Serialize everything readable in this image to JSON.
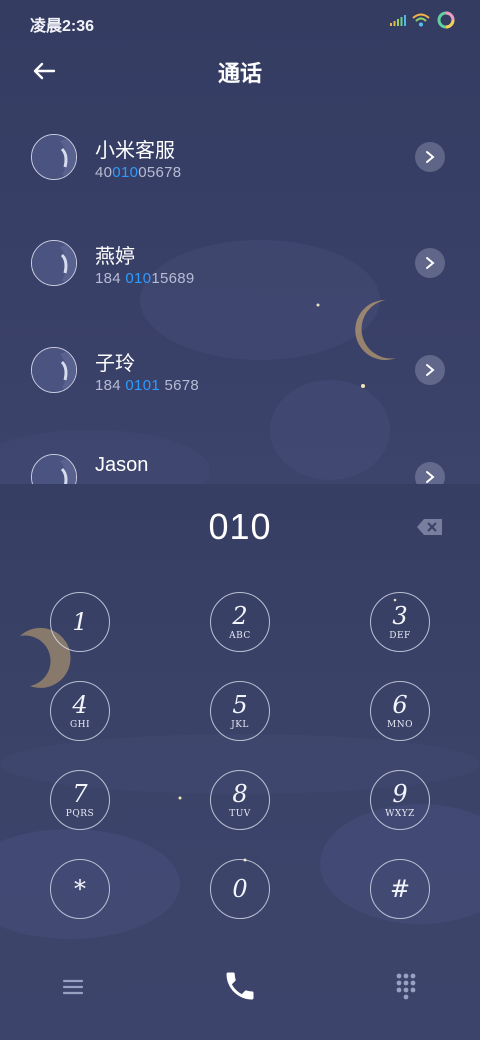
{
  "status_bar": {
    "time": "凌晨2:36",
    "icons": [
      "signal-icon",
      "wifi-icon",
      "status-ring-icon"
    ]
  },
  "header": {
    "title": "通话",
    "back_icon": "back-arrow-icon"
  },
  "contacts": [
    {
      "name": "小米客服",
      "number_parts": [
        "40",
        "010",
        "05678"
      ]
    },
    {
      "name": "燕婷",
      "number_parts": [
        "184 ",
        "010",
        "15689"
      ]
    },
    {
      "name": "子玲",
      "number_parts": [
        "184 ",
        "0101",
        " 5678"
      ]
    },
    {
      "name": "Jason",
      "number_parts": [
        "",
        "",
        ""
      ]
    }
  ],
  "dialer": {
    "typed_number": "010",
    "keys": [
      {
        "digit": "1",
        "letters": ""
      },
      {
        "digit": "2",
        "letters": "ABC"
      },
      {
        "digit": "3",
        "letters": "DEF"
      },
      {
        "digit": "4",
        "letters": "GHI"
      },
      {
        "digit": "5",
        "letters": "JKL"
      },
      {
        "digit": "6",
        "letters": "MNO"
      },
      {
        "digit": "7",
        "letters": "PQRS"
      },
      {
        "digit": "8",
        "letters": "TUV"
      },
      {
        "digit": "9",
        "letters": "WXYZ"
      },
      {
        "digit": "*",
        "letters": ""
      },
      {
        "digit": "0",
        "letters": ""
      },
      {
        "digit": "#",
        "letters": ""
      }
    ]
  },
  "bottom_bar": {
    "icons": [
      "menu-icon",
      "call-icon",
      "dialpad-icon"
    ]
  },
  "colors": {
    "background": "#3a4169",
    "highlight": "#2f9bff",
    "secondary_text": "#b7bcd4"
  }
}
